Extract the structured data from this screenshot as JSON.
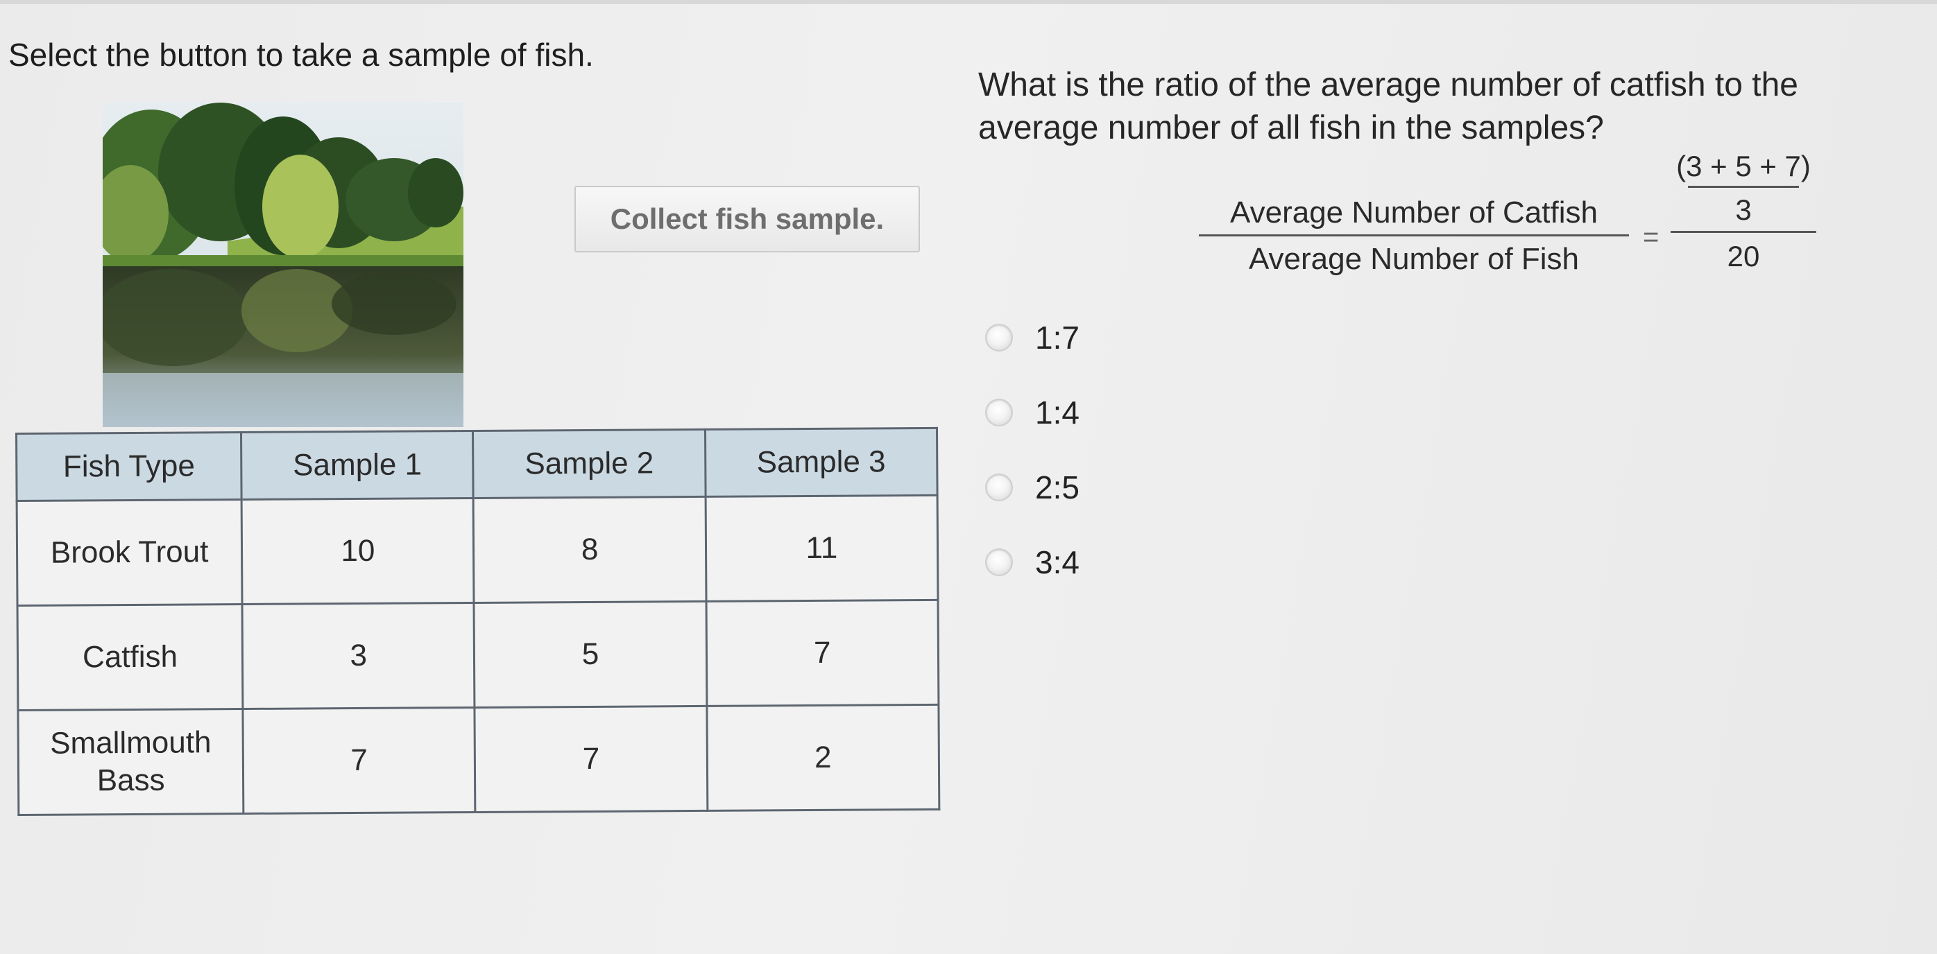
{
  "instruction": "Select the button to take a sample of fish.",
  "sample_button_label": "Collect fish sample.",
  "table": {
    "headers": [
      "Fish Type",
      "Sample 1",
      "Sample 2",
      "Sample 3"
    ],
    "rows": [
      [
        "Brook Trout",
        "10",
        "8",
        "11"
      ],
      [
        "Catfish",
        "3",
        "5",
        "7"
      ],
      [
        "Smallmouth\nBass",
        "7",
        "7",
        "2"
      ]
    ]
  },
  "question": "What is the ratio of the average number of catfish to the average number of all fish in the samples?",
  "formula": {
    "lhs_numerator": "Average Number of Catfish",
    "lhs_denominator": "Average Number of Fish",
    "equals": "=",
    "rhs_inner_numerator": "(3 + 5 + 7)",
    "rhs_inner_denominator": "3",
    "rhs_denominator": "20"
  },
  "options": [
    "1:7",
    "1:4",
    "2:5",
    "3:4"
  ]
}
